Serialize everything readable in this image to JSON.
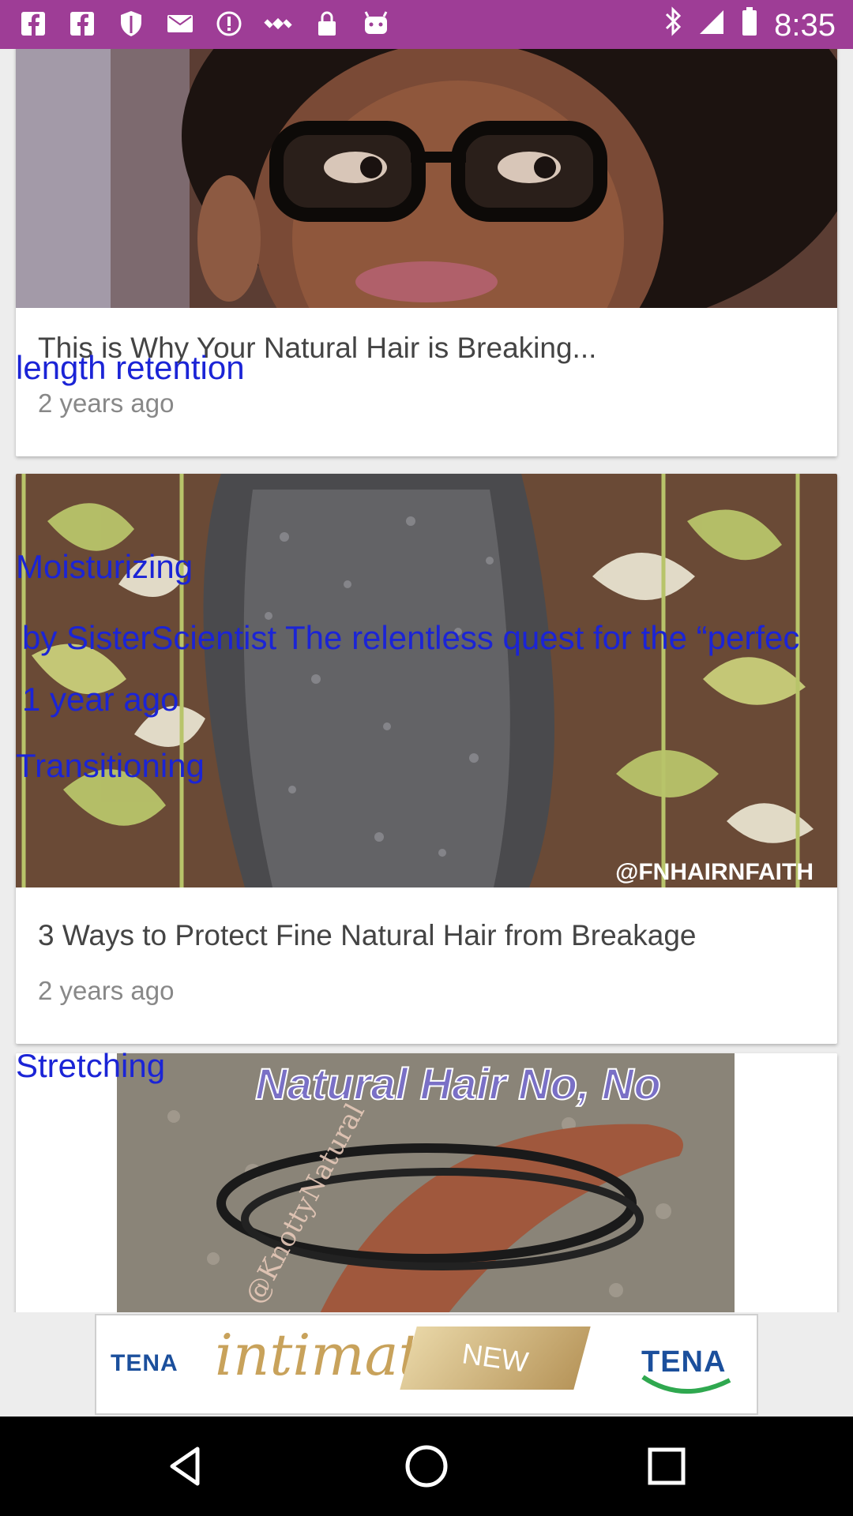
{
  "status_bar": {
    "time": "8:35",
    "bg_color": "#9e3d96",
    "icons": [
      "facebook-icon",
      "facebook-icon",
      "shield-icon",
      "mail-icon",
      "circle-icon",
      "satellite-icon",
      "lock-icon",
      "android-icon"
    ],
    "right_icons": [
      "bluetooth-icon",
      "signal-icon",
      "battery-icon"
    ]
  },
  "cards": [
    {
      "title": "This is Why Your Natural Hair is Breaking...",
      "time_ago": "2 years ago"
    },
    {
      "title": "3 Ways to Protect Fine Natural Hair from Breakage",
      "time_ago": "2 years ago",
      "image_caption": "@FNHAIRNFAITH"
    },
    {
      "image_caption": "Natural Hair No, No",
      "image_watermark": "@KnottyNatural"
    }
  ],
  "overlays": {
    "length_retention": "length retention",
    "moisturizing": "Moisturizing",
    "excerpt": "by SisterScientist The relentless quest for the    “perfec",
    "time_ago": "1 year ago",
    "transitioning": "Transitioning",
    "stretching": "Stretching"
  },
  "ad": {
    "brand_left": "TENA",
    "word": "intimates",
    "ribbon": "NEW",
    "brand_right": "TENA"
  },
  "nav_bar": {
    "buttons": [
      "back-icon",
      "home-icon",
      "recents-icon"
    ]
  }
}
